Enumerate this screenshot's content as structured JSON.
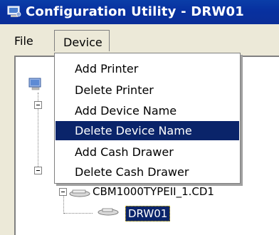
{
  "window": {
    "title": "Configuration Utility - DRW01"
  },
  "menubar": {
    "file_label": "File",
    "device_label": "Device"
  },
  "device_menu": {
    "items": [
      {
        "label": "Add Printer",
        "highlighted": false
      },
      {
        "label": "Delete Printer",
        "highlighted": false
      },
      {
        "label": "Add Device Name",
        "highlighted": false
      },
      {
        "label": "Delete Device Name",
        "highlighted": true
      },
      {
        "label": "Add Cash Drawer",
        "highlighted": false
      },
      {
        "label": "Delete Cash Drawer",
        "highlighted": false
      }
    ]
  },
  "tree": {
    "printer_node": "CBM1000TYPEII_1.CD1",
    "drawer_node": "DRW01"
  },
  "colors": {
    "title_bar": "#0a2e98",
    "highlight": "#0a246a",
    "menu_bg": "#ece9d8"
  }
}
